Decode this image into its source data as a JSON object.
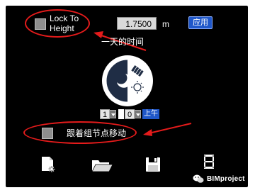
{
  "panel": {
    "lock_to_height_label": "Lock To\nHeight",
    "height_value": "1.7500",
    "height_unit": "m",
    "apply_label": "应用",
    "time_of_day_label": "一天的时间",
    "time": {
      "hour": "1",
      "minute": "0",
      "ampm": "上午"
    },
    "follow_node_label": "跟着组节点移动"
  },
  "watermark": {
    "text": "BIMproject"
  },
  "annotations": {
    "ellipse_color": "#e51b1b",
    "arrow_color": "#e51b1b"
  },
  "icons": {
    "new_file": "new-file-icon",
    "open_folder": "open-folder-icon",
    "save": "save-icon",
    "film_strip": "film-strip-icon"
  }
}
